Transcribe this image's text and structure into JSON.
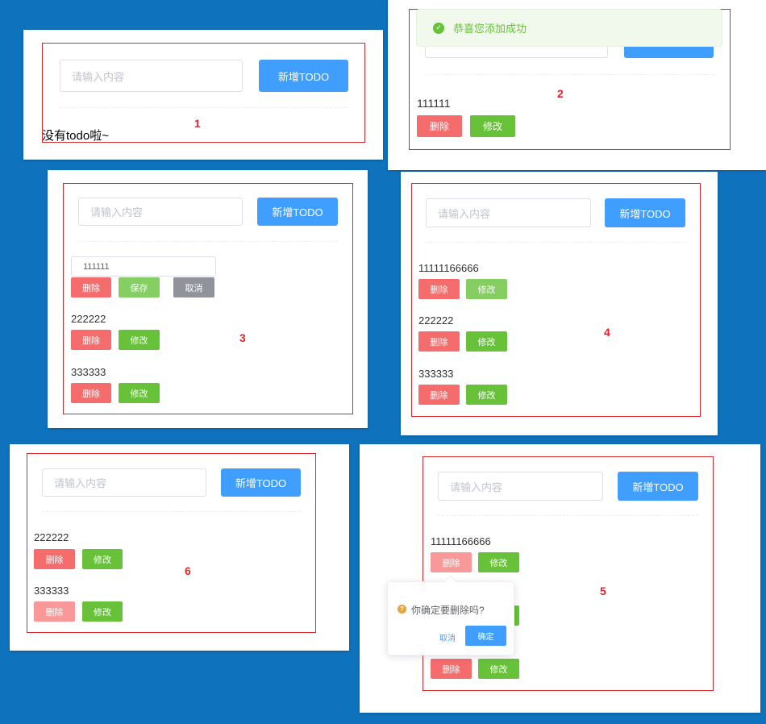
{
  "common": {
    "input_placeholder": "请输入内容",
    "add_label": "新增TODO",
    "delete_label": "删除",
    "edit_label": "修改",
    "save_label": "保存",
    "cancel_label": "取消"
  },
  "panel1": {
    "number": "1",
    "empty_text": "没有todo啦~"
  },
  "panel2": {
    "number": "2",
    "toast": "恭喜您添加成功",
    "todos": [
      "111111"
    ]
  },
  "panel3": {
    "number": "3",
    "editing_value": "111111",
    "todos": [
      "222222",
      "333333"
    ]
  },
  "panel4": {
    "number": "4",
    "todos": [
      "11111166666",
      "222222",
      "333333"
    ]
  },
  "panel5": {
    "number": "5",
    "todos": [
      "11111166666"
    ],
    "popconfirm": {
      "message": "你确定要删除吗?",
      "cancel": "取消",
      "confirm": "确定"
    }
  },
  "panel6": {
    "number": "6",
    "todos": [
      "222222",
      "333333"
    ]
  },
  "colors": {
    "primary": "#409eff",
    "danger": "#f56c6c",
    "success": "#67c23a",
    "info": "#909399",
    "frame": "#d9272e",
    "background": "#0e72bd"
  }
}
